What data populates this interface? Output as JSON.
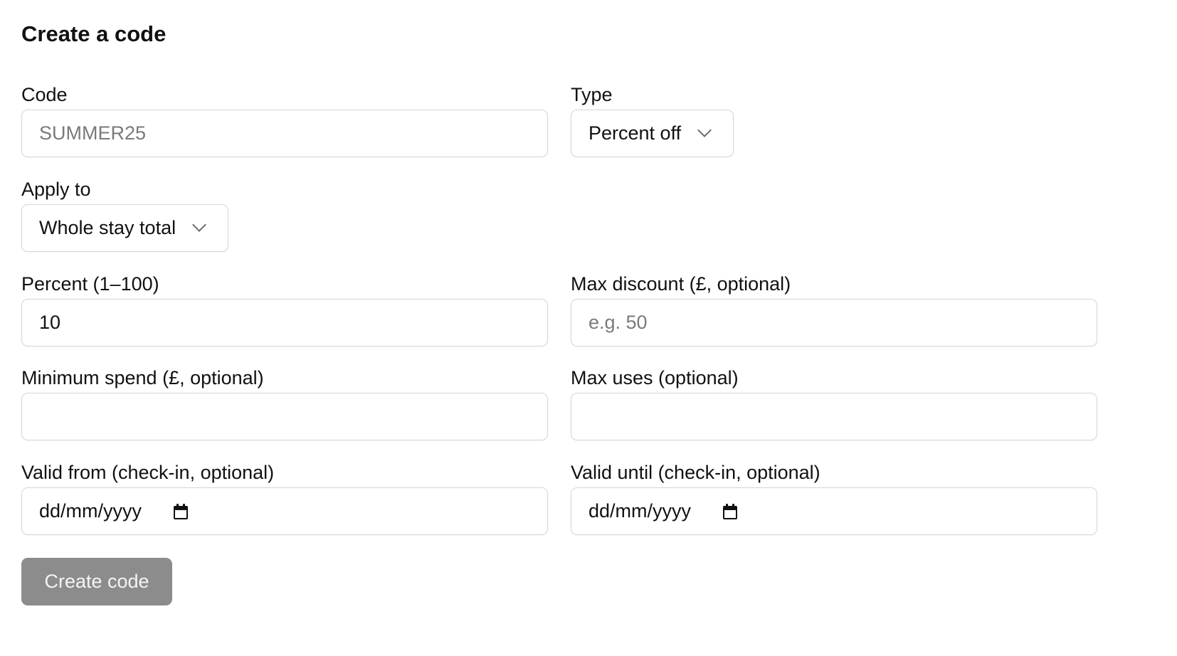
{
  "page_title": "Create a code",
  "form": {
    "code": {
      "label": "Code",
      "placeholder": "SUMMER25",
      "value": ""
    },
    "type": {
      "label": "Type",
      "selected": "Percent off"
    },
    "apply_to": {
      "label": "Apply to",
      "selected": "Whole stay total"
    },
    "percent": {
      "label": "Percent (1–100)",
      "value": "10"
    },
    "max_discount": {
      "label": "Max discount (£, optional)",
      "placeholder": "e.g. 50",
      "value": ""
    },
    "minimum_spend": {
      "label": "Minimum spend (£, optional)",
      "value": ""
    },
    "max_uses": {
      "label": "Max uses (optional)",
      "value": ""
    },
    "valid_from": {
      "label": "Valid from (check-in, optional)",
      "display": "dd/mm/yyyy"
    },
    "valid_until": {
      "label": "Valid until (check-in, optional)",
      "display": "dd/mm/yyyy"
    },
    "submit_label": "Create code"
  },
  "icons": {
    "select_chevron": "chevron-down-icon",
    "date_picker": "calendar-icon"
  },
  "colors": {
    "text": "#111111",
    "placeholder": "#7a7a7a",
    "field_border": "#d6d6d6",
    "button_disabled_bg": "#8c8c8c",
    "button_text": "#f4f4f4"
  }
}
